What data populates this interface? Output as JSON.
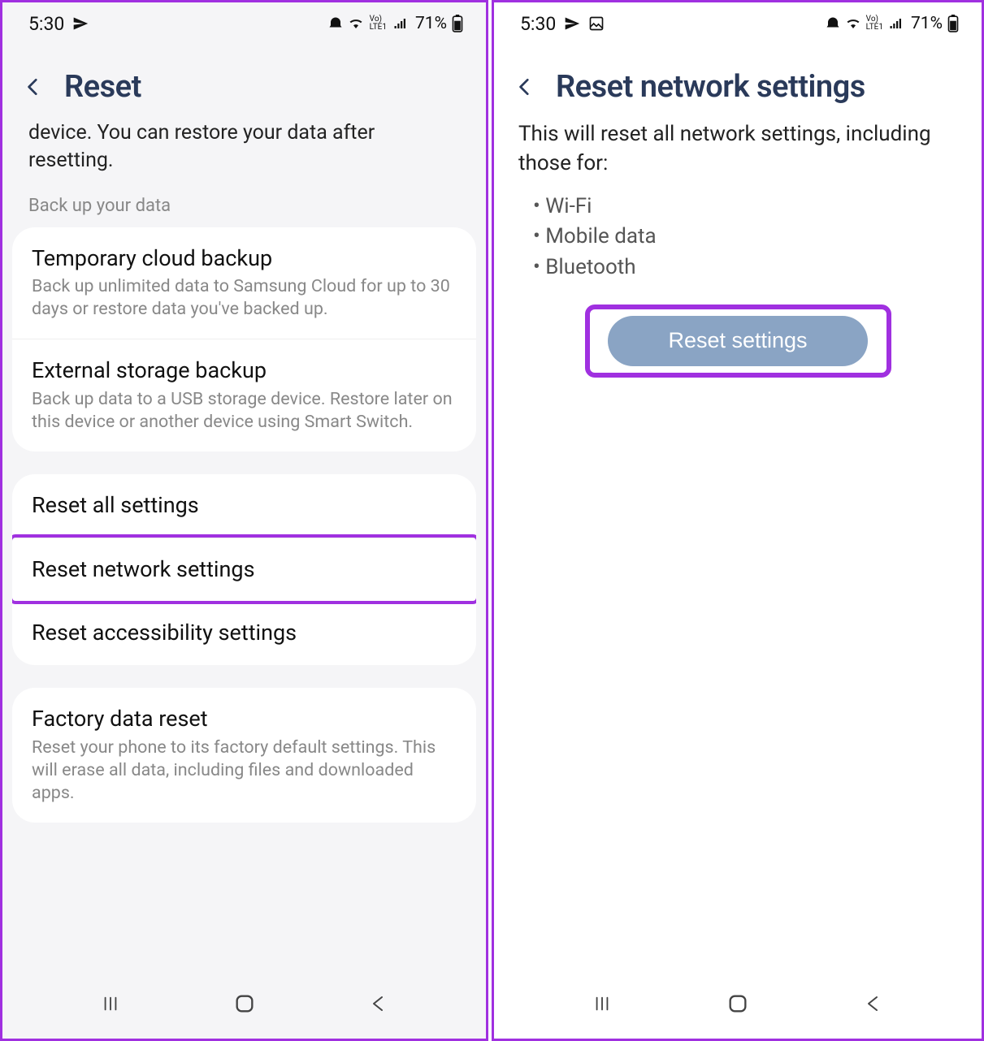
{
  "status": {
    "time": "5:30",
    "battery_pct": "71%"
  },
  "left": {
    "title": "Reset",
    "intro": "device. You can restore your data after resetting.",
    "backup_label": "Back up your data",
    "backup_items": [
      {
        "title": "Temporary cloud backup",
        "sub": "Back up unlimited data to Samsung Cloud for up to 30 days or restore data you've backed up."
      },
      {
        "title": "External storage backup",
        "sub": "Back up data to a USB storage device. Restore later on this device or another device using Smart Switch."
      }
    ],
    "reset_items": [
      {
        "title": "Reset all settings"
      },
      {
        "title": "Reset network settings"
      },
      {
        "title": "Reset accessibility settings"
      }
    ],
    "factory": {
      "title": "Factory data reset",
      "sub": "Reset your phone to its factory default settings. This will erase all data, including files and downloaded apps."
    }
  },
  "right": {
    "title": "Reset network settings",
    "intro": "This will reset all network settings, including those for:",
    "bullets": [
      "Wi-Fi",
      "Mobile data",
      "Bluetooth"
    ],
    "button": "Reset settings"
  }
}
